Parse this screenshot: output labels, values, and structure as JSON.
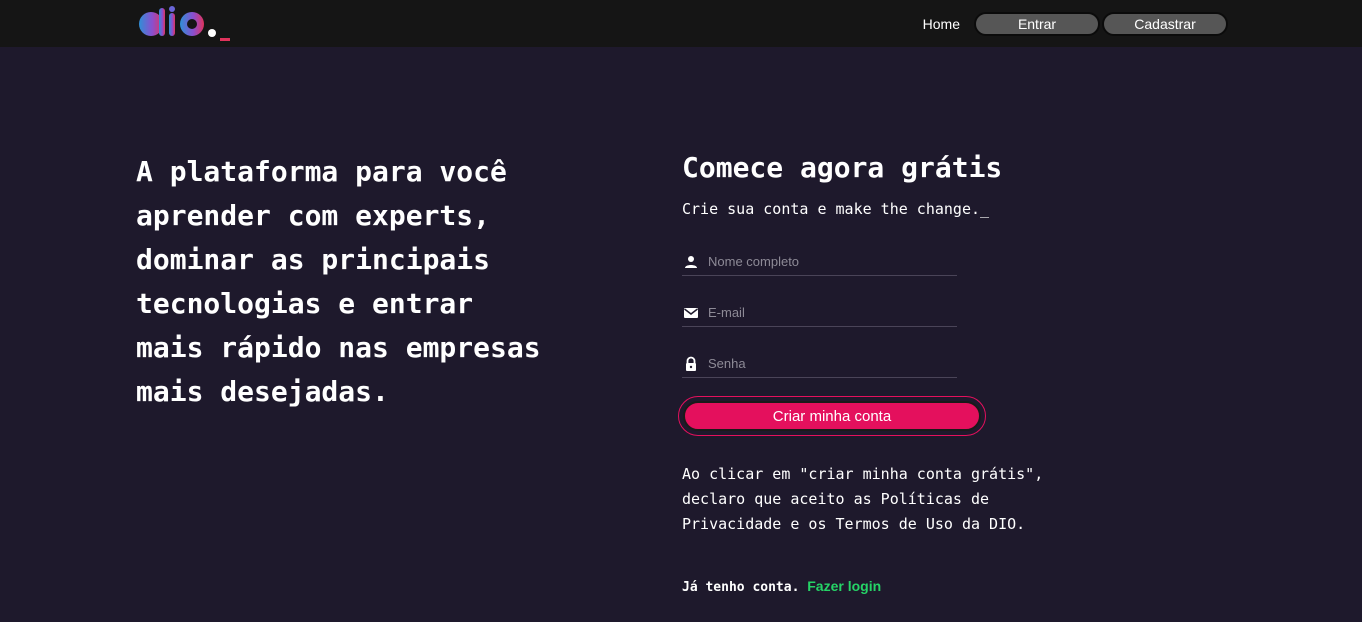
{
  "header": {
    "logo_text": "dio._",
    "nav": {
      "home_label": "Home",
      "enter_label": "Entrar",
      "signup_label": "Cadastrar"
    }
  },
  "hero": {
    "headline": "A plataforma para você aprender com experts, dominar as principais tecnologias e entrar mais rápido nas empresas mais desejadas."
  },
  "signup": {
    "title": "Comece agora grátis",
    "subtitle": "Crie sua conta e make the change._",
    "fields": [
      {
        "icon": "person-icon",
        "placeholder": "Nome completo",
        "value": ""
      },
      {
        "icon": "mail-icon",
        "placeholder": "E-mail",
        "value": ""
      },
      {
        "icon": "lock-icon",
        "placeholder": "Senha",
        "value": ""
      }
    ],
    "submit_label": "Criar minha conta",
    "terms": "Ao clicar em \"criar minha conta grátis\", declaro que aceito as Políticas de Privacidade e os Termos de Uso da DIO.",
    "login_prompt": "Já tenho conta.",
    "login_link": "Fazer login"
  },
  "colors": {
    "background": "#1e192c",
    "topbar": "#151515",
    "accent": "#e4105d",
    "link": "#25d366",
    "nav_button": "#565656"
  }
}
